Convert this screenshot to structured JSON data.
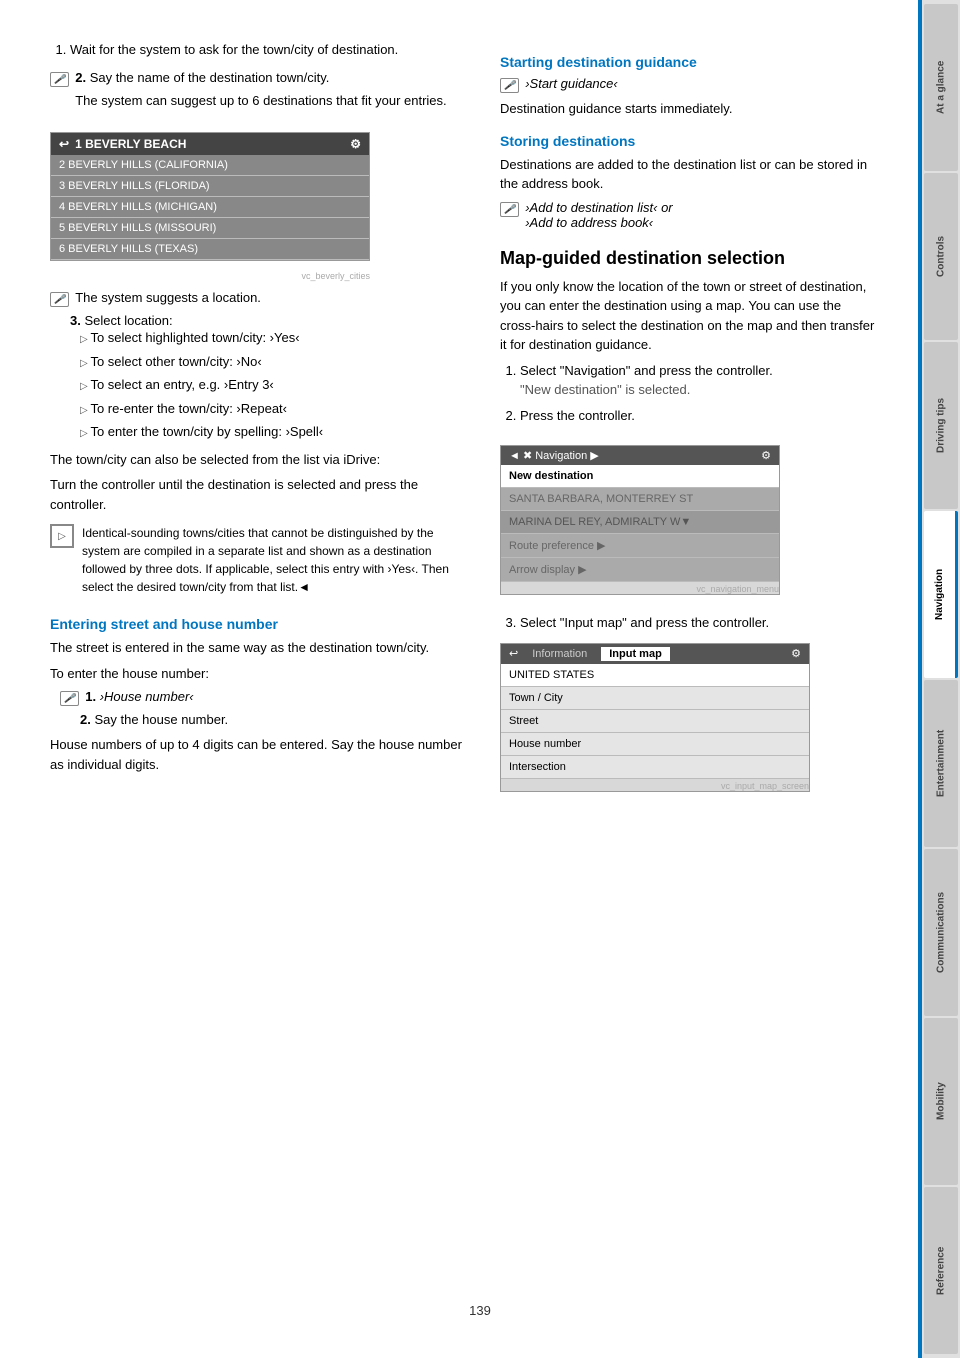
{
  "sidebar": {
    "tabs": [
      {
        "label": "At a glance",
        "active": false
      },
      {
        "label": "Controls",
        "active": false
      },
      {
        "label": "Driving tips",
        "active": false
      },
      {
        "label": "Navigation",
        "active": true
      },
      {
        "label": "Entertainment",
        "active": false
      },
      {
        "label": "Communications",
        "active": false
      },
      {
        "label": "Mobility",
        "active": false
      },
      {
        "label": "Reference",
        "active": false
      }
    ]
  },
  "page_number": "139",
  "left_col": {
    "step1": "Wait for the system to ask for the town/city of destination.",
    "step2_voice": "2.",
    "step2": "Say the name of the destination town/city.",
    "step2_note": "The system can suggest up to 6 destinations that fit your entries.",
    "screen1": {
      "selected_item": "1 BEVERLY BEACH",
      "items": [
        "2 BEVERLY HILLS (CALIFORNIA)",
        "3 BEVERLY HILLS (FLORIDA)",
        "4 BEVERLY HILLS (MICHIGAN)",
        "5 BEVERLY HILLS (MISSOURI)",
        "6 BEVERLY HILLS (TEXAS)"
      ]
    },
    "system_suggests": "The system suggests a location.",
    "step3_label": "3.",
    "step3": "Select location:",
    "bullets": [
      "To select highlighted town/city: ›Yes‹",
      "To select other town/city: ›No‹",
      "To select an entry, e.g. ›Entry 3‹",
      "To re-enter the town/city: ›Repeat‹",
      "To enter the town/city by spelling: ›Spell‹"
    ],
    "para1": "The town/city can also be selected from the list via iDrive:",
    "para2": "Turn the controller until the destination is selected and press the controller.",
    "note_text": "Identical-sounding towns/cities that cannot be distinguished by the system are compiled in a separate list and shown as a destination followed by three dots. If applicable, select this entry with ›Yes‹. Then select the desired town/city from that list.◄",
    "entering_heading": "Entering street and house number",
    "entering_para": "The street is entered in the same way as the destination town/city.",
    "entering_house_label": "To enter the house number:",
    "house_step1_voice": "1.",
    "house_step1": "›House number‹",
    "house_step2": "2.",
    "house_step2_text": "Say the house number.",
    "house_note": "House numbers of up to 4 digits can be entered. Say the house number as individual digits."
  },
  "right_col": {
    "starting_heading": "Starting destination guidance",
    "starting_voice_cmd": "›Start guidance‹",
    "starting_para": "Destination guidance starts immediately.",
    "storing_heading": "Storing destinations",
    "storing_para": "Destinations are added to the destination list or can be stored in the address book.",
    "storing_cmd1": "›Add to destination list‹ or",
    "storing_cmd2": "›Add to address book‹",
    "mapguided_heading": "Map-guided destination selection",
    "mapguided_para": "If you only know the location of the town or street of destination, you can enter the destination using a map. You can use the cross-hairs to select the destination on the map and then transfer it for destination guidance.",
    "step1_label": "1.",
    "step1": "Select \"Navigation\" and press the controller.",
    "step1_note": "\"New destination\" is selected.",
    "step2_label": "2.",
    "step2": "Press the controller.",
    "nav_screen": {
      "header_left": "◄ ✖ Navigation ▶",
      "header_right": "⚙",
      "row1": "New destination",
      "row2": "SANTA BARBARA, MONTERREY ST",
      "row3": "MARINA DEL REY, ADMIRALTY W▼",
      "row4": "Route preference ▶",
      "row5": "Arrow display ▶"
    },
    "step3_label": "3.",
    "step3": "Select \"Input map\" and press the controller.",
    "input_screen": {
      "header_back": "◄",
      "header_tab1": "Information",
      "header_tab2": "Input map",
      "row1": "UNITED STATES",
      "row2": "Town / City",
      "row3": "Street",
      "row4": "House number",
      "row5": "Intersection"
    }
  }
}
